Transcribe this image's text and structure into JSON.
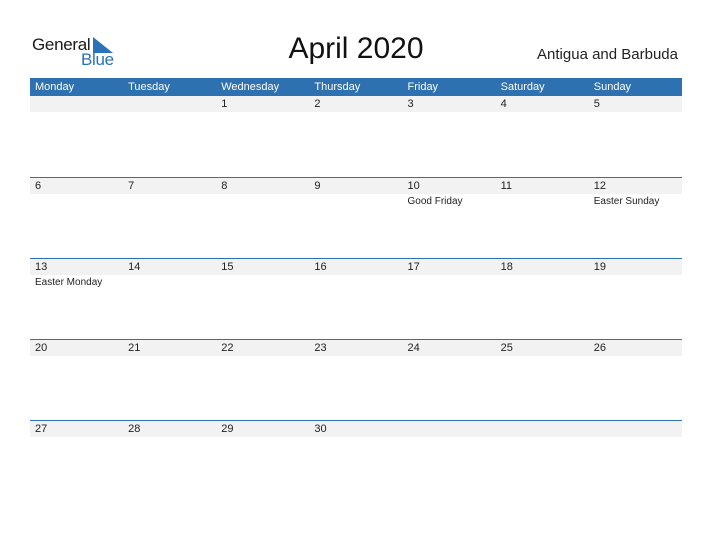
{
  "logo": {
    "text_general": "General",
    "text_blue": "Blue"
  },
  "title": "April 2020",
  "country": "Antigua and Barbuda",
  "accent_color": "#2e71b1",
  "weekdays": [
    "Monday",
    "Tuesday",
    "Wednesday",
    "Thursday",
    "Friday",
    "Saturday",
    "Sunday"
  ],
  "weeks": [
    {
      "days": [
        "",
        "",
        "1",
        "2",
        "3",
        "4",
        "5"
      ],
      "events": [
        "",
        "",
        "",
        "",
        "",
        "",
        ""
      ]
    },
    {
      "days": [
        "6",
        "7",
        "8",
        "9",
        "10",
        "11",
        "12"
      ],
      "events": [
        "",
        "",
        "",
        "",
        "Good Friday",
        "",
        "Easter Sunday"
      ]
    },
    {
      "days": [
        "13",
        "14",
        "15",
        "16",
        "17",
        "18",
        "19"
      ],
      "events": [
        "Easter Monday",
        "",
        "",
        "",
        "",
        "",
        ""
      ]
    },
    {
      "days": [
        "20",
        "21",
        "22",
        "23",
        "24",
        "25",
        "26"
      ],
      "events": [
        "",
        "",
        "",
        "",
        "",
        "",
        ""
      ]
    },
    {
      "days": [
        "27",
        "28",
        "29",
        "30",
        "",
        "",
        ""
      ],
      "events": [
        "",
        "",
        "",
        "",
        "",
        "",
        ""
      ]
    }
  ]
}
